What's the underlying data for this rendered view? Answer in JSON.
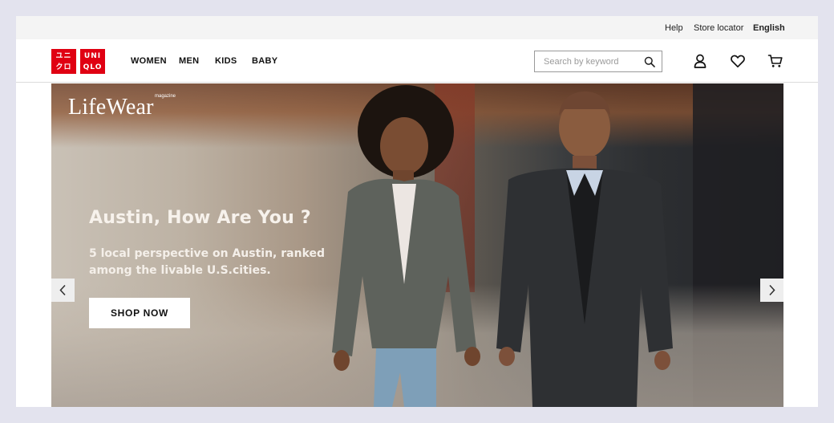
{
  "utility": {
    "help": "Help",
    "store_locator": "Store locator",
    "language": "English"
  },
  "logo": {
    "tile_1": [
      "ユニ",
      "クロ"
    ],
    "tile_2": [
      "UNI",
      "QLO"
    ],
    "brand_color": "#e00012"
  },
  "nav": {
    "women": "WOMEN",
    "men": "MEN",
    "kids": "KIDS",
    "baby": "BABY"
  },
  "search": {
    "placeholder": "Search by keyword",
    "value": ""
  },
  "icons": {
    "search": "search-icon",
    "account": "account-icon",
    "wishlist": "heart-icon",
    "cart": "cart-icon",
    "prev": "chevron-left-icon",
    "next": "chevron-right-icon"
  },
  "hero": {
    "brand": "LifeWear",
    "brand_sup": "magazine",
    "headline": "Austin, How Are You ?",
    "subline": "5 local perspective on Austin, ranked among the livable U.S.cities.",
    "cta": "SHOP NOW"
  }
}
